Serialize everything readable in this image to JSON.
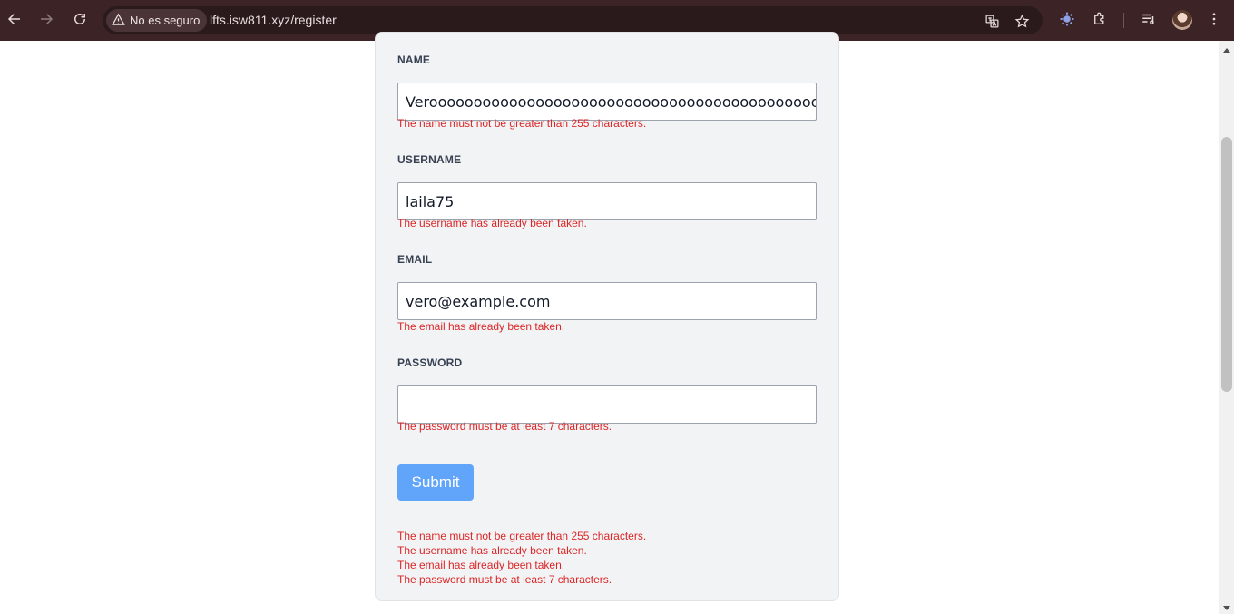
{
  "browser": {
    "security_label": "No es seguro",
    "url": "lfts.isw811.xyz/register"
  },
  "form": {
    "name": {
      "label": "NAME",
      "value": "Verooooooooooooooooooooooooooooooooooooooooooooooooooooooooooooooooooooooooo",
      "error": "The name must not be greater than 255 characters."
    },
    "username": {
      "label": "USERNAME",
      "value": "laila75",
      "error": "The username has already been taken."
    },
    "email": {
      "label": "EMAIL",
      "value": "vero@example.com",
      "error": "The email has already been taken."
    },
    "password": {
      "label": "PASSWORD",
      "value": "",
      "error": "The password must be at least 7 characters."
    },
    "submit_label": "Submit",
    "error_summary": [
      "The name must not be greater than 255 characters.",
      "The username has already been taken.",
      "The email has already been taken.",
      "The password must be at least 7 characters."
    ]
  }
}
